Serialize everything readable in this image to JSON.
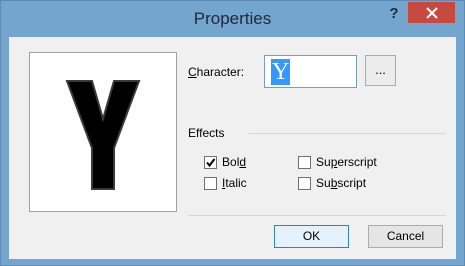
{
  "dialog": {
    "title": "Properties",
    "help_label": "?"
  },
  "character": {
    "label_first": "C",
    "label_rest": "haracter:",
    "value": "Y",
    "browse_label": "..."
  },
  "effects": {
    "label": "Effects",
    "options": [
      {
        "first": "B",
        "mid": "ol",
        "ul": "d",
        "rest": "",
        "checked": true
      },
      {
        "first": "",
        "mid": "",
        "ul": "I",
        "rest": "talic",
        "checked": false
      },
      {
        "first": "Su",
        "mid": "",
        "ul": "p",
        "rest": "erscript",
        "checked": false
      },
      {
        "first": "Su",
        "mid": "",
        "ul": "b",
        "rest": "script",
        "checked": false
      }
    ]
  },
  "buttons": {
    "ok": "OK",
    "cancel": "Cancel"
  },
  "colors": {
    "frame": "#74a5cf",
    "close": "#c7493f",
    "selection": "#3399ff"
  }
}
